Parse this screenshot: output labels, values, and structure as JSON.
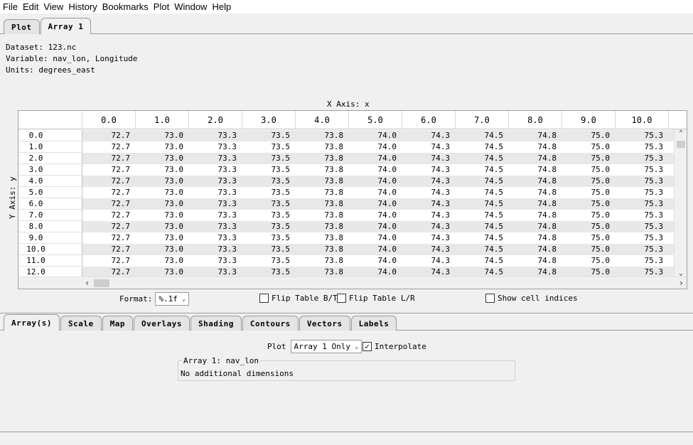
{
  "menu": [
    "File",
    "Edit",
    "View",
    "History",
    "Bookmarks",
    "Plot",
    "Window",
    "Help"
  ],
  "top_tabs": [
    {
      "label": "Plot",
      "active": false
    },
    {
      "label": "Array 1",
      "active": true
    }
  ],
  "info": {
    "dataset": "Dataset: 123.nc",
    "variable": "Variable: nav_lon, Longitude",
    "units": "Units: degrees_east"
  },
  "table": {
    "x_axis_label": "X Axis: x",
    "y_axis_label": "Y Axis: y",
    "columns": [
      "0.0",
      "1.0",
      "2.0",
      "3.0",
      "4.0",
      "5.0",
      "6.0",
      "7.0",
      "8.0",
      "9.0",
      "10.0"
    ],
    "row_labels": [
      "0.0",
      "1.0",
      "2.0",
      "3.0",
      "4.0",
      "5.0",
      "6.0",
      "7.0",
      "8.0",
      "9.0",
      "10.0",
      "11.0",
      "12.0"
    ],
    "row_values": [
      "72.7",
      "73.0",
      "73.3",
      "73.5",
      "73.8",
      "74.0",
      "74.3",
      "74.5",
      "74.8",
      "75.0",
      "75.3"
    ]
  },
  "controls": {
    "format_label": "Format:",
    "format_value": "%.1f",
    "flip_bt_label": "Flip Table B/T",
    "flip_bt_checked": false,
    "flip_lr_label": "Flip Table L/R",
    "flip_lr_checked": false,
    "show_indices_label": "Show cell indices",
    "show_indices_checked": false
  },
  "bottom_tabs": [
    {
      "label": "Array(s)",
      "active": true
    },
    {
      "label": "Scale",
      "active": false
    },
    {
      "label": "Map",
      "active": false
    },
    {
      "label": "Overlays",
      "active": false
    },
    {
      "label": "Shading",
      "active": false
    },
    {
      "label": "Contours",
      "active": false
    },
    {
      "label": "Vectors",
      "active": false
    },
    {
      "label": "Labels",
      "active": false
    }
  ],
  "plot_options": {
    "plot_label": "Plot",
    "plot_value": "Array 1 Only",
    "interpolate_label": "Interpolate",
    "interpolate_checked": true,
    "group_title": "Array 1: nav_lon",
    "group_body": "No additional dimensions"
  }
}
